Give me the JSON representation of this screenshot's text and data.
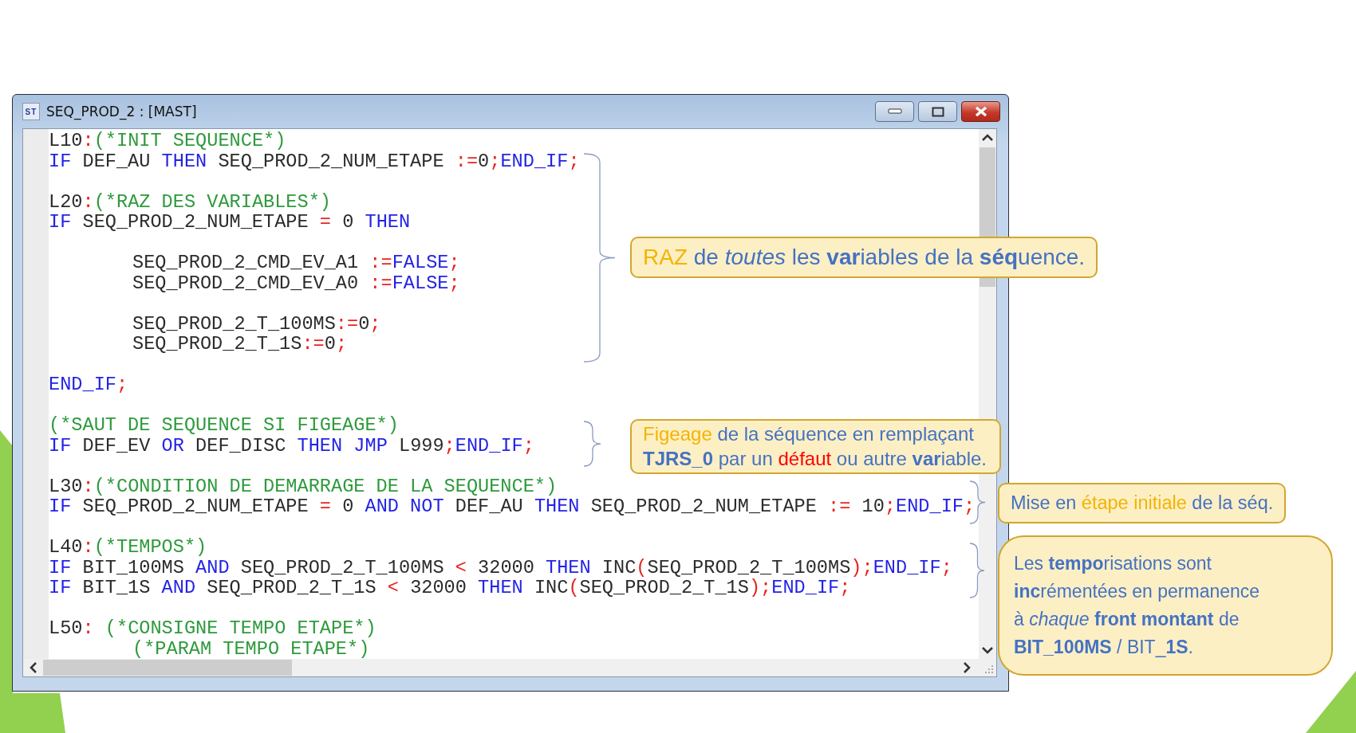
{
  "window": {
    "title": "SEQ_PROD_2 : [MAST]",
    "icon_label": "ST"
  },
  "code_lines": [
    {
      "kind": "code",
      "indented": false,
      "tokens": [
        {
          "kind": "name",
          "text": "L10"
        },
        {
          "kind": "op",
          "text": ":"
        },
        {
          "kind": "comment",
          "text": "(*INIT SEQUENCE*)"
        }
      ]
    },
    {
      "kind": "code",
      "indented": false,
      "tokens": [
        {
          "kind": "keyword",
          "text": "IF"
        },
        {
          "kind": "name",
          "text": " DEF_AU "
        },
        {
          "kind": "keyword",
          "text": "THEN"
        },
        {
          "kind": "name",
          "text": " SEQ_PROD_2_NUM_ETAPE "
        },
        {
          "kind": "op",
          "text": ":="
        },
        {
          "kind": "name",
          "text": "0"
        },
        {
          "kind": "op",
          "text": ";"
        },
        {
          "kind": "keyword",
          "text": "END_IF"
        },
        {
          "kind": "op",
          "text": ";"
        }
      ]
    },
    {
      "kind": "blank"
    },
    {
      "kind": "code",
      "indented": false,
      "tokens": [
        {
          "kind": "name",
          "text": "L20"
        },
        {
          "kind": "op",
          "text": ":"
        },
        {
          "kind": "comment",
          "text": "(*RAZ DES VARIABLES*)"
        }
      ]
    },
    {
      "kind": "code",
      "indented": false,
      "tokens": [
        {
          "kind": "keyword",
          "text": "IF"
        },
        {
          "kind": "name",
          "text": " SEQ_PROD_2_NUM_ETAPE "
        },
        {
          "kind": "op",
          "text": "="
        },
        {
          "kind": "name",
          "text": " 0 "
        },
        {
          "kind": "keyword",
          "text": "THEN"
        }
      ]
    },
    {
      "kind": "blank"
    },
    {
      "kind": "code",
      "indented": true,
      "tokens": [
        {
          "kind": "name",
          "text": "SEQ_PROD_2_CMD_EV_A1 "
        },
        {
          "kind": "op",
          "text": ":="
        },
        {
          "kind": "keyword",
          "text": "FALSE"
        },
        {
          "kind": "op",
          "text": ";"
        }
      ]
    },
    {
      "kind": "code",
      "indented": true,
      "tokens": [
        {
          "kind": "name",
          "text": "SEQ_PROD_2_CMD_EV_A0 "
        },
        {
          "kind": "op",
          "text": ":="
        },
        {
          "kind": "keyword",
          "text": "FALSE"
        },
        {
          "kind": "op",
          "text": ";"
        }
      ]
    },
    {
      "kind": "blank"
    },
    {
      "kind": "code",
      "indented": true,
      "tokens": [
        {
          "kind": "name",
          "text": "SEQ_PROD_2_T_100MS"
        },
        {
          "kind": "op",
          "text": ":="
        },
        {
          "kind": "name",
          "text": "0"
        },
        {
          "kind": "op",
          "text": ";"
        }
      ]
    },
    {
      "kind": "code",
      "indented": true,
      "tokens": [
        {
          "kind": "name",
          "text": "SEQ_PROD_2_T_1S"
        },
        {
          "kind": "op",
          "text": ":="
        },
        {
          "kind": "name",
          "text": "0"
        },
        {
          "kind": "op",
          "text": ";"
        }
      ]
    },
    {
      "kind": "blank"
    },
    {
      "kind": "code",
      "indented": false,
      "tokens": [
        {
          "kind": "keyword",
          "text": "END_IF"
        },
        {
          "kind": "op",
          "text": ";"
        }
      ]
    },
    {
      "kind": "blank"
    },
    {
      "kind": "code",
      "indented": false,
      "tokens": [
        {
          "kind": "comment",
          "text": "(*SAUT DE SEQUENCE SI FIGEAGE*)"
        }
      ]
    },
    {
      "kind": "code",
      "indented": false,
      "tokens": [
        {
          "kind": "keyword",
          "text": "IF"
        },
        {
          "kind": "name",
          "text": " DEF_EV "
        },
        {
          "kind": "keyword",
          "text": "OR"
        },
        {
          "kind": "name",
          "text": " DEF_DISC "
        },
        {
          "kind": "keyword",
          "text": "THEN JMP"
        },
        {
          "kind": "name",
          "text": " L999"
        },
        {
          "kind": "op",
          "text": ";"
        },
        {
          "kind": "keyword",
          "text": "END_IF"
        },
        {
          "kind": "op",
          "text": ";"
        }
      ]
    },
    {
      "kind": "blank"
    },
    {
      "kind": "code",
      "indented": false,
      "tokens": [
        {
          "kind": "name",
          "text": "L30"
        },
        {
          "kind": "op",
          "text": ":"
        },
        {
          "kind": "comment",
          "text": "(*CONDITION DE DEMARRAGE DE LA SEQUENCE*)"
        }
      ]
    },
    {
      "kind": "code",
      "indented": false,
      "tokens": [
        {
          "kind": "keyword",
          "text": "IF"
        },
        {
          "kind": "name",
          "text": " SEQ_PROD_2_NUM_ETAPE "
        },
        {
          "kind": "op",
          "text": "="
        },
        {
          "kind": "name",
          "text": " 0 "
        },
        {
          "kind": "keyword",
          "text": "AND NOT"
        },
        {
          "kind": "name",
          "text": " DEF_AU "
        },
        {
          "kind": "keyword",
          "text": "THEN"
        },
        {
          "kind": "name",
          "text": " SEQ_PROD_2_NUM_ETAPE "
        },
        {
          "kind": "op",
          "text": ":="
        },
        {
          "kind": "name",
          "text": " 10"
        },
        {
          "kind": "op",
          "text": ";"
        },
        {
          "kind": "keyword",
          "text": "END_IF"
        },
        {
          "kind": "op",
          "text": ";"
        }
      ]
    },
    {
      "kind": "blank"
    },
    {
      "kind": "code",
      "indented": false,
      "tokens": [
        {
          "kind": "name",
          "text": "L40"
        },
        {
          "kind": "op",
          "text": ":"
        },
        {
          "kind": "comment",
          "text": "(*TEMPOS*)"
        }
      ]
    },
    {
      "kind": "code",
      "indented": false,
      "tokens": [
        {
          "kind": "keyword",
          "text": "IF"
        },
        {
          "kind": "name",
          "text": " BIT_100MS "
        },
        {
          "kind": "keyword",
          "text": "AND"
        },
        {
          "kind": "name",
          "text": " SEQ_PROD_2_T_100MS "
        },
        {
          "kind": "op",
          "text": "<"
        },
        {
          "kind": "name",
          "text": " 32000 "
        },
        {
          "kind": "keyword",
          "text": "THEN"
        },
        {
          "kind": "name",
          "text": " INC"
        },
        {
          "kind": "op",
          "text": "("
        },
        {
          "kind": "name",
          "text": "SEQ_PROD_2_T_100MS"
        },
        {
          "kind": "op",
          "text": ");"
        },
        {
          "kind": "keyword",
          "text": "END_IF"
        },
        {
          "kind": "op",
          "text": ";"
        }
      ]
    },
    {
      "kind": "code",
      "indented": false,
      "tokens": [
        {
          "kind": "keyword",
          "text": "IF"
        },
        {
          "kind": "name",
          "text": " BIT_1S "
        },
        {
          "kind": "keyword",
          "text": "AND"
        },
        {
          "kind": "name",
          "text": " SEQ_PROD_2_T_1S "
        },
        {
          "kind": "op",
          "text": "<"
        },
        {
          "kind": "name",
          "text": " 32000 "
        },
        {
          "kind": "keyword",
          "text": "THEN"
        },
        {
          "kind": "name",
          "text": " INC"
        },
        {
          "kind": "op",
          "text": "("
        },
        {
          "kind": "name",
          "text": "SEQ_PROD_2_T_1S"
        },
        {
          "kind": "op",
          "text": ");"
        },
        {
          "kind": "keyword",
          "text": "END_IF"
        },
        {
          "kind": "op",
          "text": ";"
        }
      ]
    },
    {
      "kind": "blank"
    },
    {
      "kind": "code",
      "indented": false,
      "tokens": [
        {
          "kind": "name",
          "text": "L50"
        },
        {
          "kind": "op",
          "text": ":"
        },
        {
          "kind": "comment",
          "text": " (*CONSIGNE TEMPO ETAPE*)"
        }
      ]
    },
    {
      "kind": "code",
      "indented": true,
      "tokens": [
        {
          "kind": "comment",
          "text": "(*PARAM TEMPO ETAPE*)"
        }
      ]
    }
  ],
  "callouts": [
    {
      "lines": [
        [
          {
            "color": "#f3b400",
            "text": "RAZ"
          },
          {
            "color": "#4472c4",
            "text": " de *toutes* les **var**iables de la **séq**uence."
          }
        ]
      ]
    },
    {
      "lines": [
        [
          {
            "color": "#f3b400",
            "text": "Figeage"
          },
          {
            "color": "#4472c4",
            "text": " de la séquence en remplaçant"
          }
        ],
        [
          {
            "color": "#4472c4",
            "text": "**TJRS_0** par un "
          },
          {
            "color": "#ff0000",
            "text": "défaut"
          },
          {
            "color": "#4472c4",
            "text": " ou autre **var**iable."
          }
        ]
      ]
    },
    {
      "lines": [
        [
          {
            "color": "#4472c4",
            "text": "Mise en "
          },
          {
            "color": "#f3b400",
            "text": "étape initiale"
          },
          {
            "color": "#4472c4",
            "text": " de la séq."
          }
        ]
      ]
    },
    {
      "lines": [
        [
          {
            "color": "#4472c4",
            "text": "Les **tempo**risations sont"
          }
        ],
        [
          {
            "color": "#4472c4",
            "text": "**inc**rémentées en permanence"
          }
        ],
        [
          {
            "color": "#4472c4",
            "text": "à *chaque* **front montant** de"
          }
        ],
        [
          {
            "color": "#4472c4",
            "text": "**BIT_100MS** / BIT_**1S**."
          }
        ]
      ]
    }
  ]
}
